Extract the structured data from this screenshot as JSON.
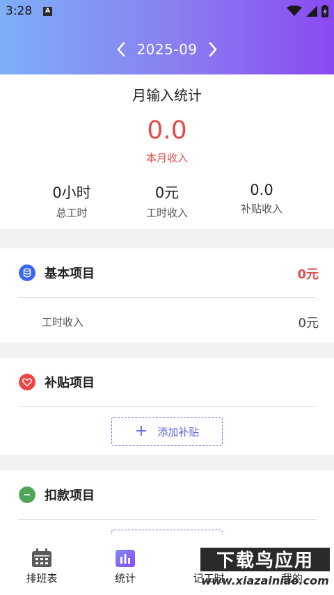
{
  "status_bar": {
    "time": "3:28",
    "notification_icon": "A"
  },
  "month_nav": {
    "month": "2025-09",
    "prev_icon": "chevron-left-icon",
    "next_icon": "chevron-right-icon"
  },
  "summary": {
    "title": "月输入统计",
    "income_value": "0.0",
    "income_label": "本月收入",
    "stats": [
      {
        "value": "0小时",
        "label": "总工时"
      },
      {
        "value": "0元",
        "label": "工时收入"
      },
      {
        "value": "0.0",
        "label": "补贴收入"
      }
    ]
  },
  "basic_section": {
    "title": "基本项目",
    "amount": "0元",
    "rows": [
      {
        "label": "工时收入",
        "value": "0元"
      }
    ],
    "icon_color": "#3a67f0"
  },
  "subsidy_section": {
    "title": "补贴项目",
    "add_label": "添加补贴",
    "icon_color": "#ee4545"
  },
  "deduction_section": {
    "title": "扣款项目",
    "icon_color": "#4ea55a"
  },
  "bottom_nav": {
    "items": [
      {
        "label": "排班表",
        "icon": "calendar-icon"
      },
      {
        "label": "统计",
        "icon": "stats-icon"
      },
      {
        "label": "记工时",
        "icon": "record-icon"
      },
      {
        "label": "我的",
        "icon": "profile-icon"
      }
    ]
  },
  "watermark": {
    "title": "下载鸟应用",
    "url": "www.xiazainiao.com"
  },
  "colors": {
    "accent": "#5d62e8",
    "income_red": "#e14a4a",
    "header_start": "#7eaff8",
    "header_end": "#8a49f1"
  }
}
